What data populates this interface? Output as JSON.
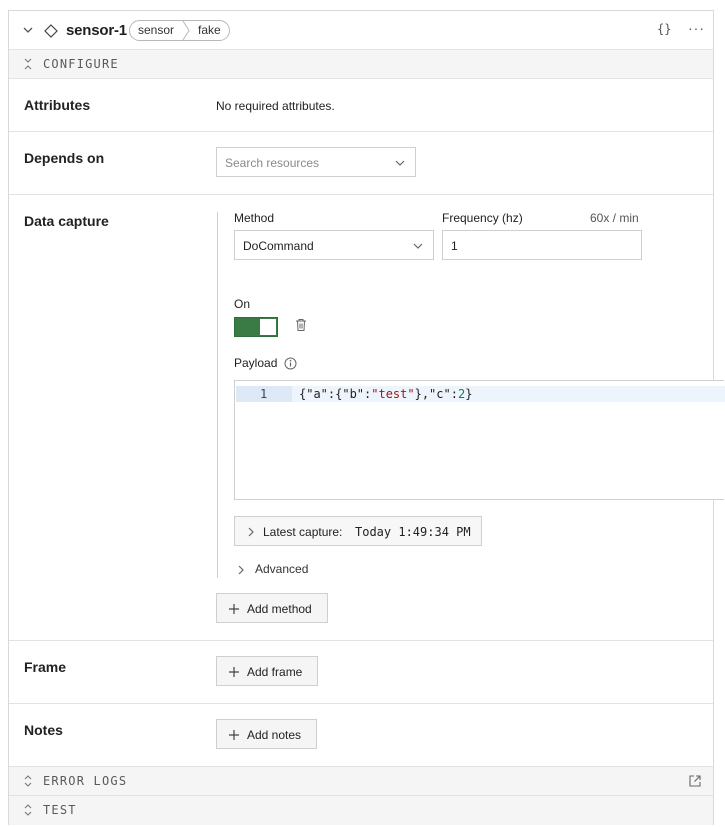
{
  "header": {
    "title": "sensor-1",
    "breadcrumb": [
      "sensor",
      "fake"
    ],
    "json_label": "{}",
    "more_label": "···"
  },
  "sections": {
    "configure": "CONFIGURE",
    "error_logs": "ERROR LOGS",
    "test": "TEST"
  },
  "attributes": {
    "label": "Attributes",
    "value": "No required attributes."
  },
  "depends_on": {
    "label": "Depends on",
    "placeholder": "Search resources"
  },
  "data_capture": {
    "label": "Data capture",
    "method_label": "Method",
    "method_value": "DoCommand",
    "frequency_label": "Frequency (hz)",
    "frequency_value": "1",
    "rate": "60x / min",
    "on_label": "On",
    "payload_label": "Payload",
    "payload_line_number": "1",
    "payload_tokens": {
      "p1": "{\"a\":{\"b\":",
      "s1": "\"test\"",
      "p2": "},\"c\":",
      "n1": "2",
      "p3": "}"
    },
    "latest_capture_label": "Latest capture:",
    "latest_capture_value": "Today 1:49:34 PM",
    "advanced_label": "Advanced",
    "add_method_label": "Add method"
  },
  "frame": {
    "label": "Frame",
    "add_label": "Add frame"
  },
  "notes": {
    "label": "Notes",
    "add_label": "Add notes"
  },
  "colors": {
    "toggle_on": "#3a7a45",
    "border": "#cfcfcf",
    "section_bar": "#f5f5f5",
    "code_string": "#a31515",
    "code_number": "#098658"
  }
}
